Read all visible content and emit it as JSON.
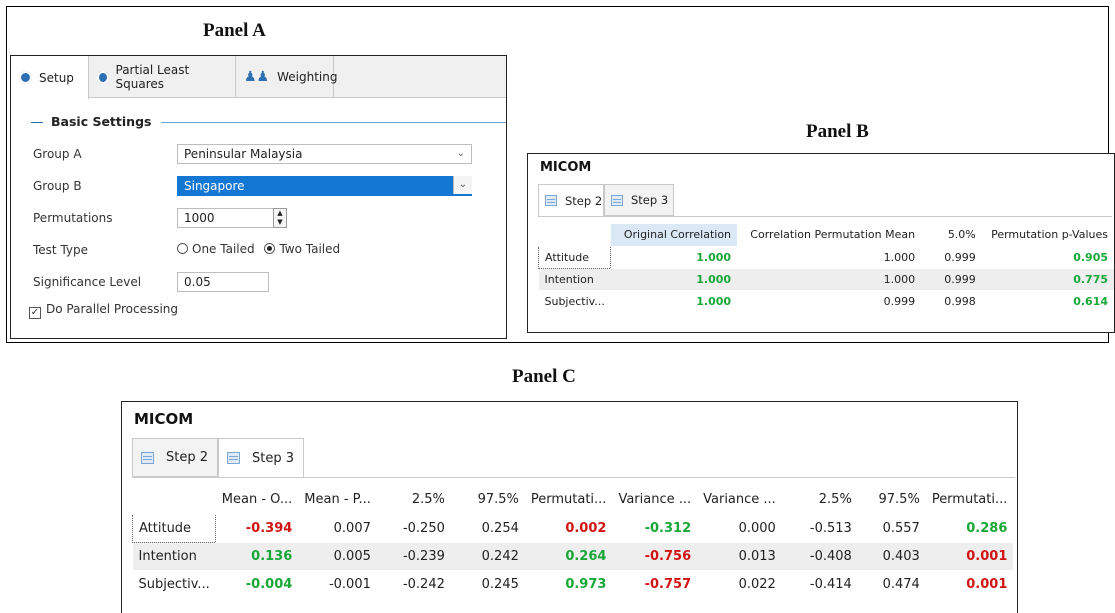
{
  "panel_a": {
    "title": "Panel A",
    "tabs": [
      {
        "label": "Setup",
        "icon": "gear-icon"
      },
      {
        "label": "Partial Least Squares",
        "icon": "gear-icon"
      },
      {
        "label": "Weighting",
        "icon": "people-icon"
      }
    ],
    "section_title": "Basic Settings",
    "group_a": {
      "label": "Group A",
      "value": "Peninsular Malaysia"
    },
    "group_b": {
      "label": "Group B",
      "value": "Singapore"
    },
    "permutations": {
      "label": "Permutations",
      "value": "1000"
    },
    "test_type": {
      "label": "Test Type",
      "options": [
        "One Tailed",
        "Two Tailed"
      ],
      "selected": "Two Tailed"
    },
    "significance": {
      "label": "Significance Level",
      "value": "0.05"
    },
    "parallel": {
      "label": "Do Parallel Processing",
      "checked": true
    }
  },
  "panel_b": {
    "title": "Panel B",
    "app_title": "MICOM",
    "tabs": [
      "Step 2",
      "Step 3"
    ],
    "active_tab": "Step 2",
    "columns": [
      "Original Correlation",
      "Correlation Permutation Mean",
      "5.0%",
      "Permutation p-Values"
    ],
    "rows": [
      {
        "name": "Attitude",
        "values": [
          "1.000",
          "1.000",
          "0.999",
          "0.905"
        ]
      },
      {
        "name": "Intention",
        "values": [
          "1.000",
          "1.000",
          "0.999",
          "0.775"
        ]
      },
      {
        "name": "Subjectiv...",
        "values": [
          "1.000",
          "0.999",
          "0.998",
          "0.614"
        ]
      }
    ]
  },
  "panel_c": {
    "title": "Panel C",
    "app_title": "MICOM",
    "tabs": [
      "Step 2",
      "Step 3"
    ],
    "active_tab": "Step 3",
    "columns": [
      "Mean - O...",
      "Mean - P...",
      "2.5%",
      "97.5%",
      "Permutati...",
      "Variance ...",
      "Variance ...",
      "2.5%",
      "97.5%",
      "Permutati..."
    ],
    "rows": [
      {
        "name": "Attitude",
        "values": [
          "-0.394",
          "0.007",
          "-0.250",
          "0.254",
          "0.002",
          "-0.312",
          "0.000",
          "-0.513",
          "0.557",
          "0.286"
        ]
      },
      {
        "name": "Intention",
        "values": [
          "0.136",
          "0.005",
          "-0.239",
          "0.242",
          "0.264",
          "-0.756",
          "0.013",
          "-0.408",
          "0.403",
          "0.001"
        ]
      },
      {
        "name": "Subjectiv...",
        "values": [
          "-0.004",
          "-0.001",
          "-0.242",
          "0.245",
          "0.973",
          "-0.757",
          "0.022",
          "-0.414",
          "0.474",
          "0.001"
        ]
      }
    ]
  },
  "colors": {
    "positive": "#19a838",
    "negative": "#d11414",
    "selection": "#1477d3",
    "accent": "#2d6fb3"
  }
}
